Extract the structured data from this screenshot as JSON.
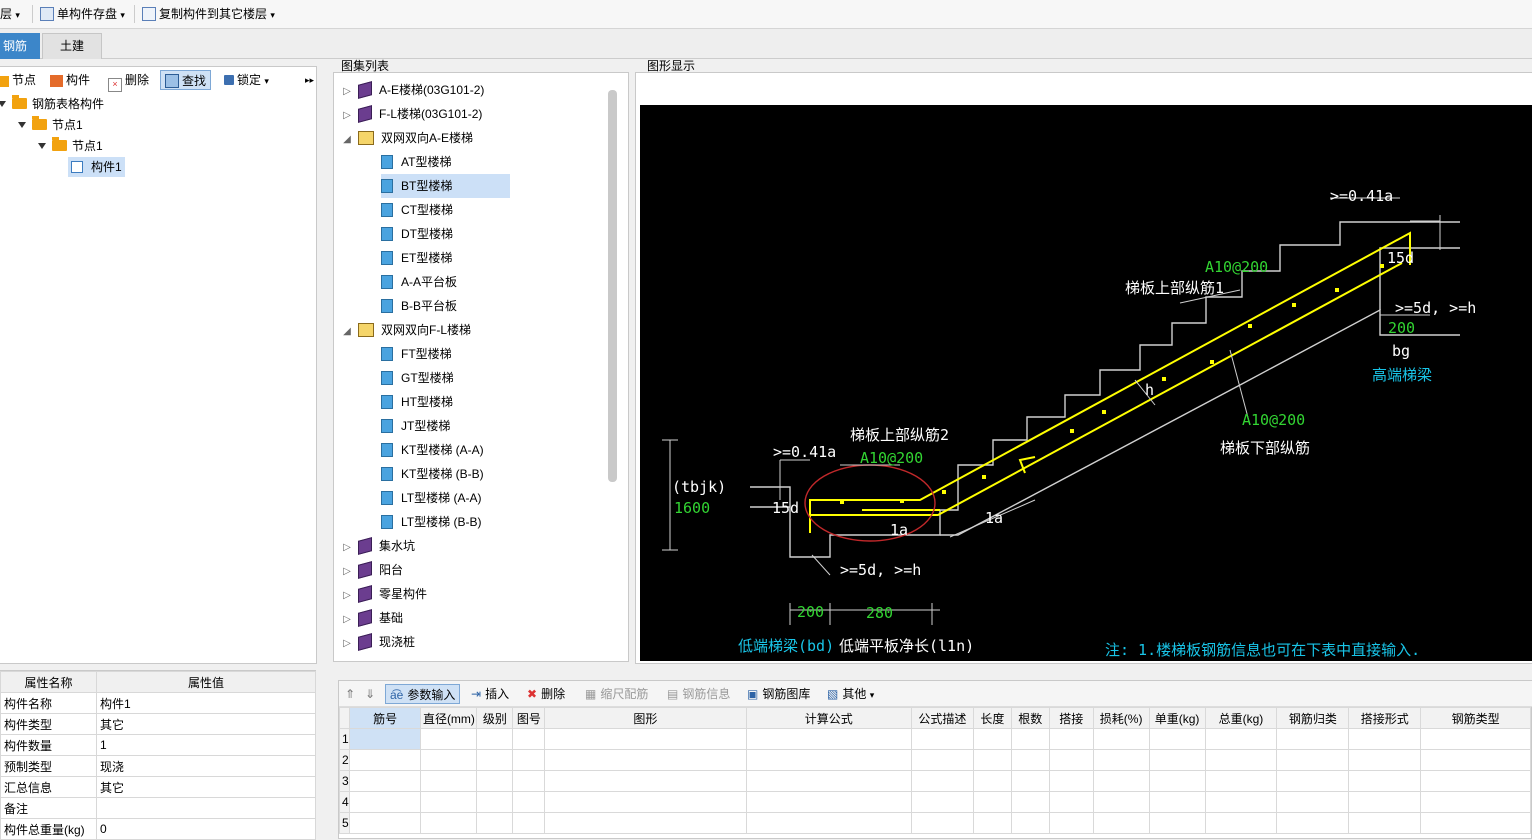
{
  "toolbar": {
    "floor_label": "层",
    "save_label": "单构件存盘",
    "copy_label": "复制构件到其它楼层"
  },
  "tabs": [
    "钢筋",
    "土建"
  ],
  "tree_toolbar": {
    "node": "节点",
    "component": "构件",
    "delete": "删除",
    "find": "查找",
    "lock": "锁定"
  },
  "tree": {
    "root": "钢筋表格构件",
    "node1": "节点1",
    "node1_child": "节点1",
    "component1": "构件1"
  },
  "props": {
    "header_name": "属性名称",
    "header_value": "属性值",
    "rows": [
      {
        "name": "构件名称",
        "value": "构件1"
      },
      {
        "name": "构件类型",
        "value": "其它"
      },
      {
        "name": "构件数量",
        "value": "1"
      },
      {
        "name": "预制类型",
        "value": "现浇"
      },
      {
        "name": "汇总信息",
        "value": "其它"
      },
      {
        "name": "备注",
        "value": ""
      },
      {
        "name": "构件总重量(kg)",
        "value": "0"
      }
    ]
  },
  "gallery": {
    "title": "图集列表",
    "items": [
      {
        "label": "A-E楼梯(03G101-2)",
        "type": "book"
      },
      {
        "label": "F-L楼梯(03G101-2)",
        "type": "book"
      },
      {
        "label": "双网双向A-E楼梯",
        "type": "open"
      },
      {
        "label": "AT型楼梯",
        "type": "page"
      },
      {
        "label": "BT型楼梯",
        "type": "page"
      },
      {
        "label": "CT型楼梯",
        "type": "page"
      },
      {
        "label": "DT型楼梯",
        "type": "page"
      },
      {
        "label": "ET型楼梯",
        "type": "page"
      },
      {
        "label": "A-A平台板",
        "type": "page"
      },
      {
        "label": "B-B平台板",
        "type": "page"
      },
      {
        "label": "双网双向F-L楼梯",
        "type": "open"
      },
      {
        "label": "FT型楼梯",
        "type": "page"
      },
      {
        "label": "GT型楼梯",
        "type": "page"
      },
      {
        "label": "HT型楼梯",
        "type": "page"
      },
      {
        "label": "JT型楼梯",
        "type": "page"
      },
      {
        "label": "KT型楼梯 (A-A)",
        "type": "page"
      },
      {
        "label": "KT型楼梯 (B-B)",
        "type": "page"
      },
      {
        "label": "LT型楼梯 (A-A)",
        "type": "page"
      },
      {
        "label": "LT型楼梯 (B-B)",
        "type": "page"
      },
      {
        "label": "集水坑",
        "type": "book"
      },
      {
        "label": "阳台",
        "type": "book"
      },
      {
        "label": "零星构件",
        "type": "book"
      },
      {
        "label": "基础",
        "type": "book"
      },
      {
        "label": "现浇桩",
        "type": "book"
      }
    ]
  },
  "graphic": {
    "title": "图形显示",
    "labels": {
      "upper1": "梯板上部纵筋1",
      "upper2": "梯板上部纵筋2",
      "lower": "梯板下部纵筋",
      "rebar_top": "A10@200",
      "rebar_low": "A10@200",
      "rebar_bottom": "A10@200",
      "anchor_top": ">=0.41a",
      "anchor_low": ">=0.41a",
      "d15_top": "15d",
      "d15_low": "15d",
      "h_top": ">=5d, >=h",
      "h_low": ">=5d, >=h",
      "w200_top": "200",
      "bg": "bg",
      "high_beam": "高端梯梁",
      "tbjk": "(tbjk)",
      "tbjk_val": "1600",
      "la1": "1a",
      "la2": "1a",
      "h": "h",
      "w200_low": "200",
      "w280": "280",
      "low_beam": "低端梯梁(bd)",
      "low_len": "低端平板净长(l1n)",
      "note": "注: 1.楼梯板钢筋信息也可在下表中直接输入."
    }
  },
  "grid_toolbar": {
    "param_input": "参数输入",
    "insert": "插入",
    "delete": "删除",
    "scale": "缩尺配筋",
    "info": "钢筋信息",
    "library": "钢筋图库",
    "other": "其他"
  },
  "grid": {
    "columns": [
      "筋号",
      "直径(mm)",
      "级别",
      "图号",
      "图形",
      "计算公式",
      "公式描述",
      "长度",
      "根数",
      "搭接",
      "损耗(%)",
      "单重(kg)",
      "总重(kg)",
      "钢筋归类",
      "搭接形式",
      "钢筋类型"
    ],
    "rows": [
      "1",
      "2",
      "3",
      "4",
      "5"
    ]
  }
}
